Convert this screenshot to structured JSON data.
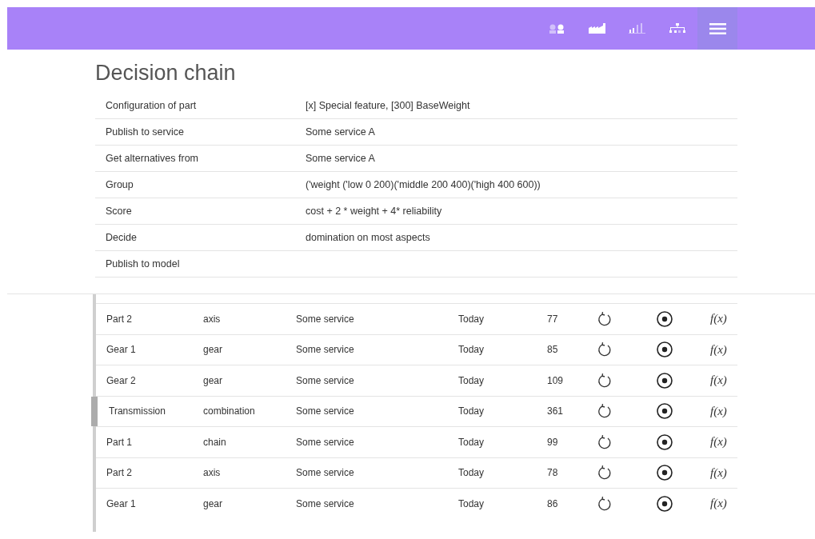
{
  "nav": [
    {
      "kind": "people",
      "selected": false
    },
    {
      "kind": "factory",
      "selected": false
    },
    {
      "kind": "bars",
      "selected": false
    },
    {
      "kind": "hierarchy",
      "selected": false
    },
    {
      "kind": "menu",
      "selected": true
    }
  ],
  "title": "Decision chain",
  "properties": [
    {
      "label": "Configuration of part",
      "value": "[x] Special feature, [300] BaseWeight"
    },
    {
      "label": "Publish to service",
      "value": "Some service A"
    },
    {
      "label": "Get alternatives from",
      "value": "Some service A"
    },
    {
      "label": "Group",
      "value": "('weight ('low 0 200)('middle 200 400)('high 400 600))"
    },
    {
      "label": "Score",
      "value": "cost + 2 * weight + 4* reliability"
    },
    {
      "label": "Decide",
      "value": "domination on most aspects"
    },
    {
      "label": "Publish to model"
    }
  ],
  "parts": [
    {
      "name": "Part 2",
      "type": "axis",
      "service": "Some service",
      "date": "Today",
      "count": "77",
      "formula": "f(x)",
      "selected": false
    },
    {
      "name": "Gear 1",
      "type": "gear",
      "service": "Some service",
      "date": "Today",
      "count": "85",
      "formula": "f(x)",
      "selected": false
    },
    {
      "name": "Gear 2",
      "type": "gear",
      "service": "Some service",
      "date": "Today",
      "count": "109",
      "formula": "f(x)",
      "selected": false
    },
    {
      "name": "Transmission",
      "type": "combination",
      "service": "Some service",
      "date": "Today",
      "count": "361",
      "formula": "f(x)",
      "selected": true
    },
    {
      "name": "Part 1",
      "type": "chain",
      "service": "Some service",
      "date": "Today",
      "count": "99",
      "formula": "f(x)",
      "selected": false
    },
    {
      "name": "Part 2",
      "type": "axis",
      "service": "Some service",
      "date": "Today",
      "count": "78",
      "formula": "f(x)",
      "selected": false
    },
    {
      "name": "Gear 1",
      "type": "gear",
      "service": "Some service",
      "date": "Today",
      "count": "86",
      "formula": "f(x)",
      "selected": false
    }
  ]
}
